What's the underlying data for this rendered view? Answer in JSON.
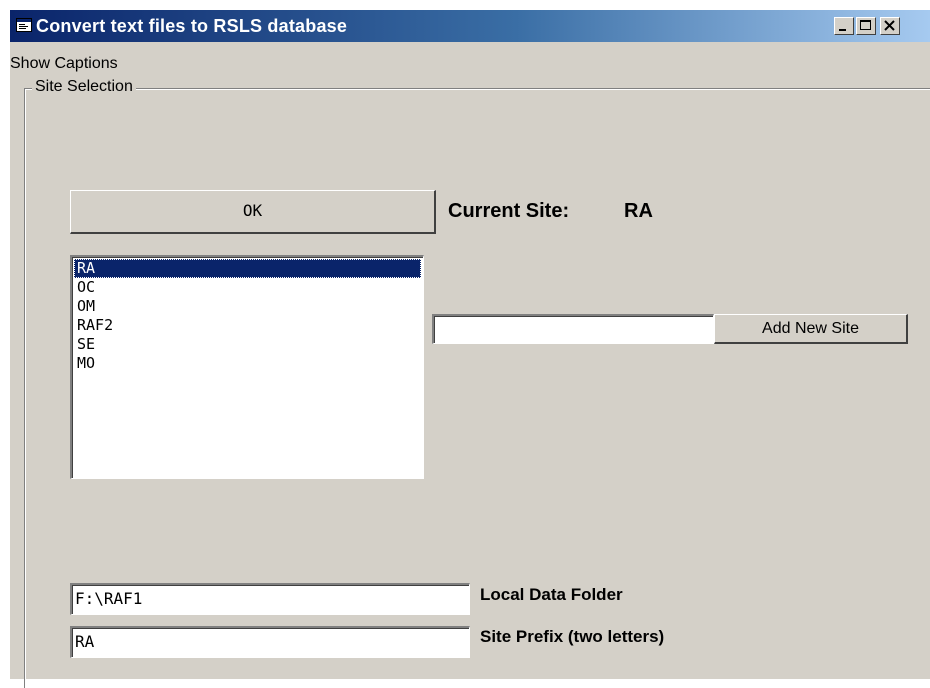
{
  "window": {
    "title": "Convert text files to RSLS database",
    "icon": "app-window-icon"
  },
  "titlebar_buttons": {
    "minimize": "minimize-icon",
    "maximize": "maximize-icon",
    "close": "close-icon"
  },
  "menu": {
    "items": [
      "Show Captions"
    ]
  },
  "site_selection": {
    "caption": "Site Selection",
    "ok_label": "OK",
    "current_site_label": "Current Site:",
    "current_site_value": "RA",
    "sites": [
      "RA",
      "OC",
      "OM",
      "RAF2",
      "SE",
      "MO"
    ],
    "selected_index": 0,
    "new_site_value": "",
    "add_new_site_label": "Add New Site",
    "local_data_folder_value": "F:\\RAF1",
    "local_data_folder_label": "Local Data Folder",
    "site_prefix_value": "RA",
    "site_prefix_label": "Site Prefix (two letters)"
  },
  "colors": {
    "titlebar_start": "#0a246a",
    "titlebar_end": "#a6caf0",
    "face": "#d4d0c8",
    "selection": "#0a246a"
  }
}
